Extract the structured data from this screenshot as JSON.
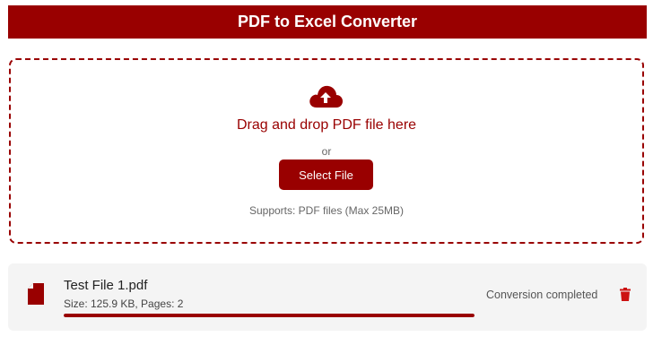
{
  "header": {
    "title": "PDF to Excel Converter"
  },
  "dropzone": {
    "title": "Drag and drop PDF file here",
    "or_text": "or",
    "button_label": "Select File",
    "supports_text": "Supports: PDF files (Max 25MB)",
    "icon": "cloud-upload-icon"
  },
  "file": {
    "name": "Test File 1.pdf",
    "meta": "Size: 125.9 KB, Pages: 2",
    "progress_percent": 100,
    "status": "Conversion completed",
    "file_icon": "pdf-file-icon",
    "delete_icon": "trash-icon"
  },
  "colors": {
    "accent": "#990000",
    "card_bg": "#f4f4f4"
  }
}
